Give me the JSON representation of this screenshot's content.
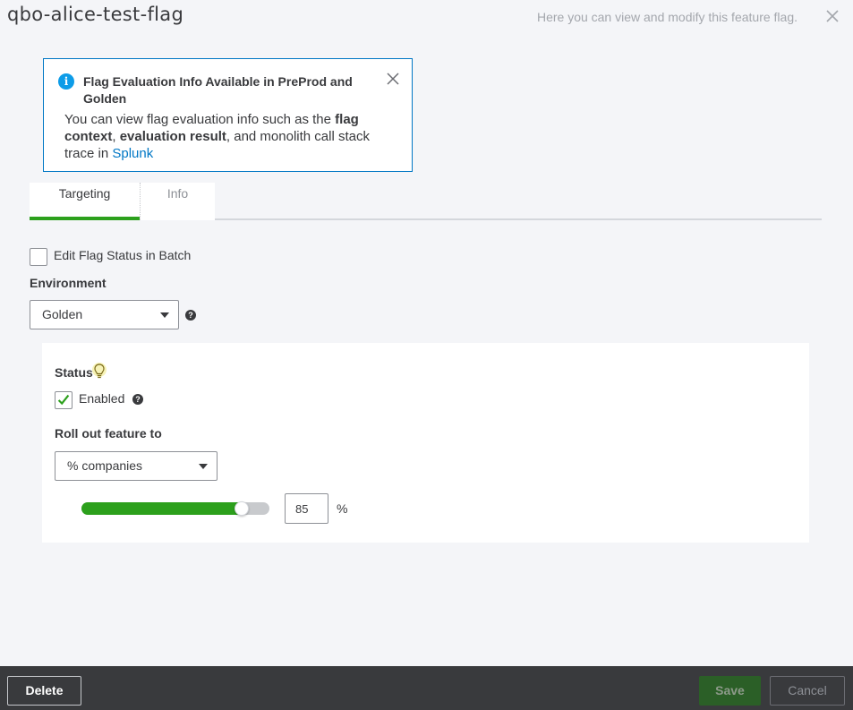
{
  "header": {
    "title": "qbo-alice-test-flag",
    "subtitle": "Here you can view and modify this feature flag."
  },
  "info_banner": {
    "title": "Flag Evaluation Info Available in PreProd and Golden",
    "body_1": "You can view flag evaluation info such as the ",
    "bold_1": "flag context",
    "body_2": ", ",
    "bold_2": "evaluation result",
    "body_3": ", and monolith call stack trace in ",
    "link": "Splunk"
  },
  "tabs": [
    {
      "label": "Targeting",
      "active": true
    },
    {
      "label": "Info",
      "active": false
    }
  ],
  "targeting": {
    "batch_label": "Edit Flag Status in Batch",
    "batch_checked": false,
    "environment_label": "Environment",
    "environment_value": "Golden",
    "status_label": "Status",
    "enabled_label": "Enabled",
    "enabled_checked": true,
    "rollout_label": "Roll out feature to",
    "rollout_value": "% companies",
    "rollout_percent": "85",
    "percent_sign": "%"
  },
  "footer": {
    "delete_label": "Delete",
    "save_label": "Save",
    "cancel_label": "Cancel"
  },
  "colors": {
    "accent_green": "#2ca01c",
    "link_blue": "#0077c5",
    "footer_bg": "#393a3d"
  }
}
